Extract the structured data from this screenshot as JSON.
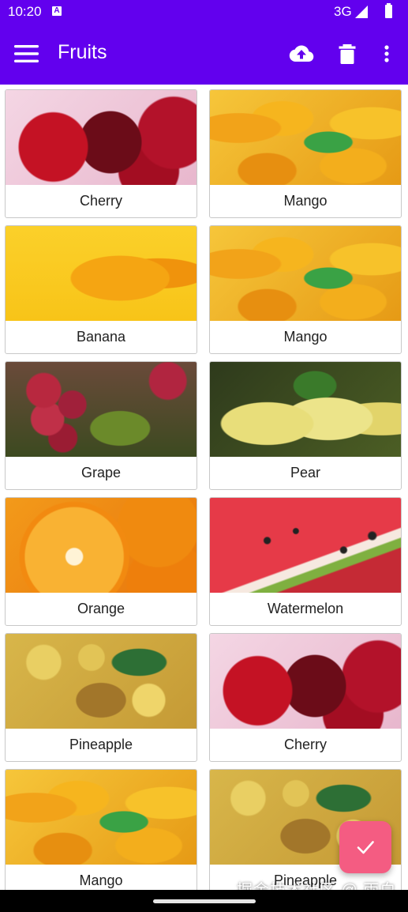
{
  "status_bar": {
    "time": "10:20",
    "notification_icon": "A",
    "network": "3G"
  },
  "toolbar": {
    "title": "Fruits",
    "icons": [
      "menu-icon",
      "cloud-upload-icon",
      "delete-icon",
      "more-vert-icon"
    ],
    "color": "#6200ee"
  },
  "grid": {
    "items": [
      {
        "label": "Cherry",
        "image": "cherry"
      },
      {
        "label": "Mango",
        "image": "mango"
      },
      {
        "label": "Banana",
        "image": "banana"
      },
      {
        "label": "Mango",
        "image": "mango"
      },
      {
        "label": "Grape",
        "image": "grape"
      },
      {
        "label": "Pear",
        "image": "pear"
      },
      {
        "label": "Orange",
        "image": "orange"
      },
      {
        "label": "Watermelon",
        "image": "watermelon"
      },
      {
        "label": "Pineapple",
        "image": "pineapple"
      },
      {
        "label": "Cherry",
        "image": "cherry"
      },
      {
        "label": "Mango",
        "image": "mango"
      },
      {
        "label": "Pineapple",
        "image": "pineapple"
      }
    ]
  },
  "fab": {
    "icon": "check-icon",
    "color": "#f45c82"
  },
  "watermark": "掘金技术社区 @ 雨白"
}
